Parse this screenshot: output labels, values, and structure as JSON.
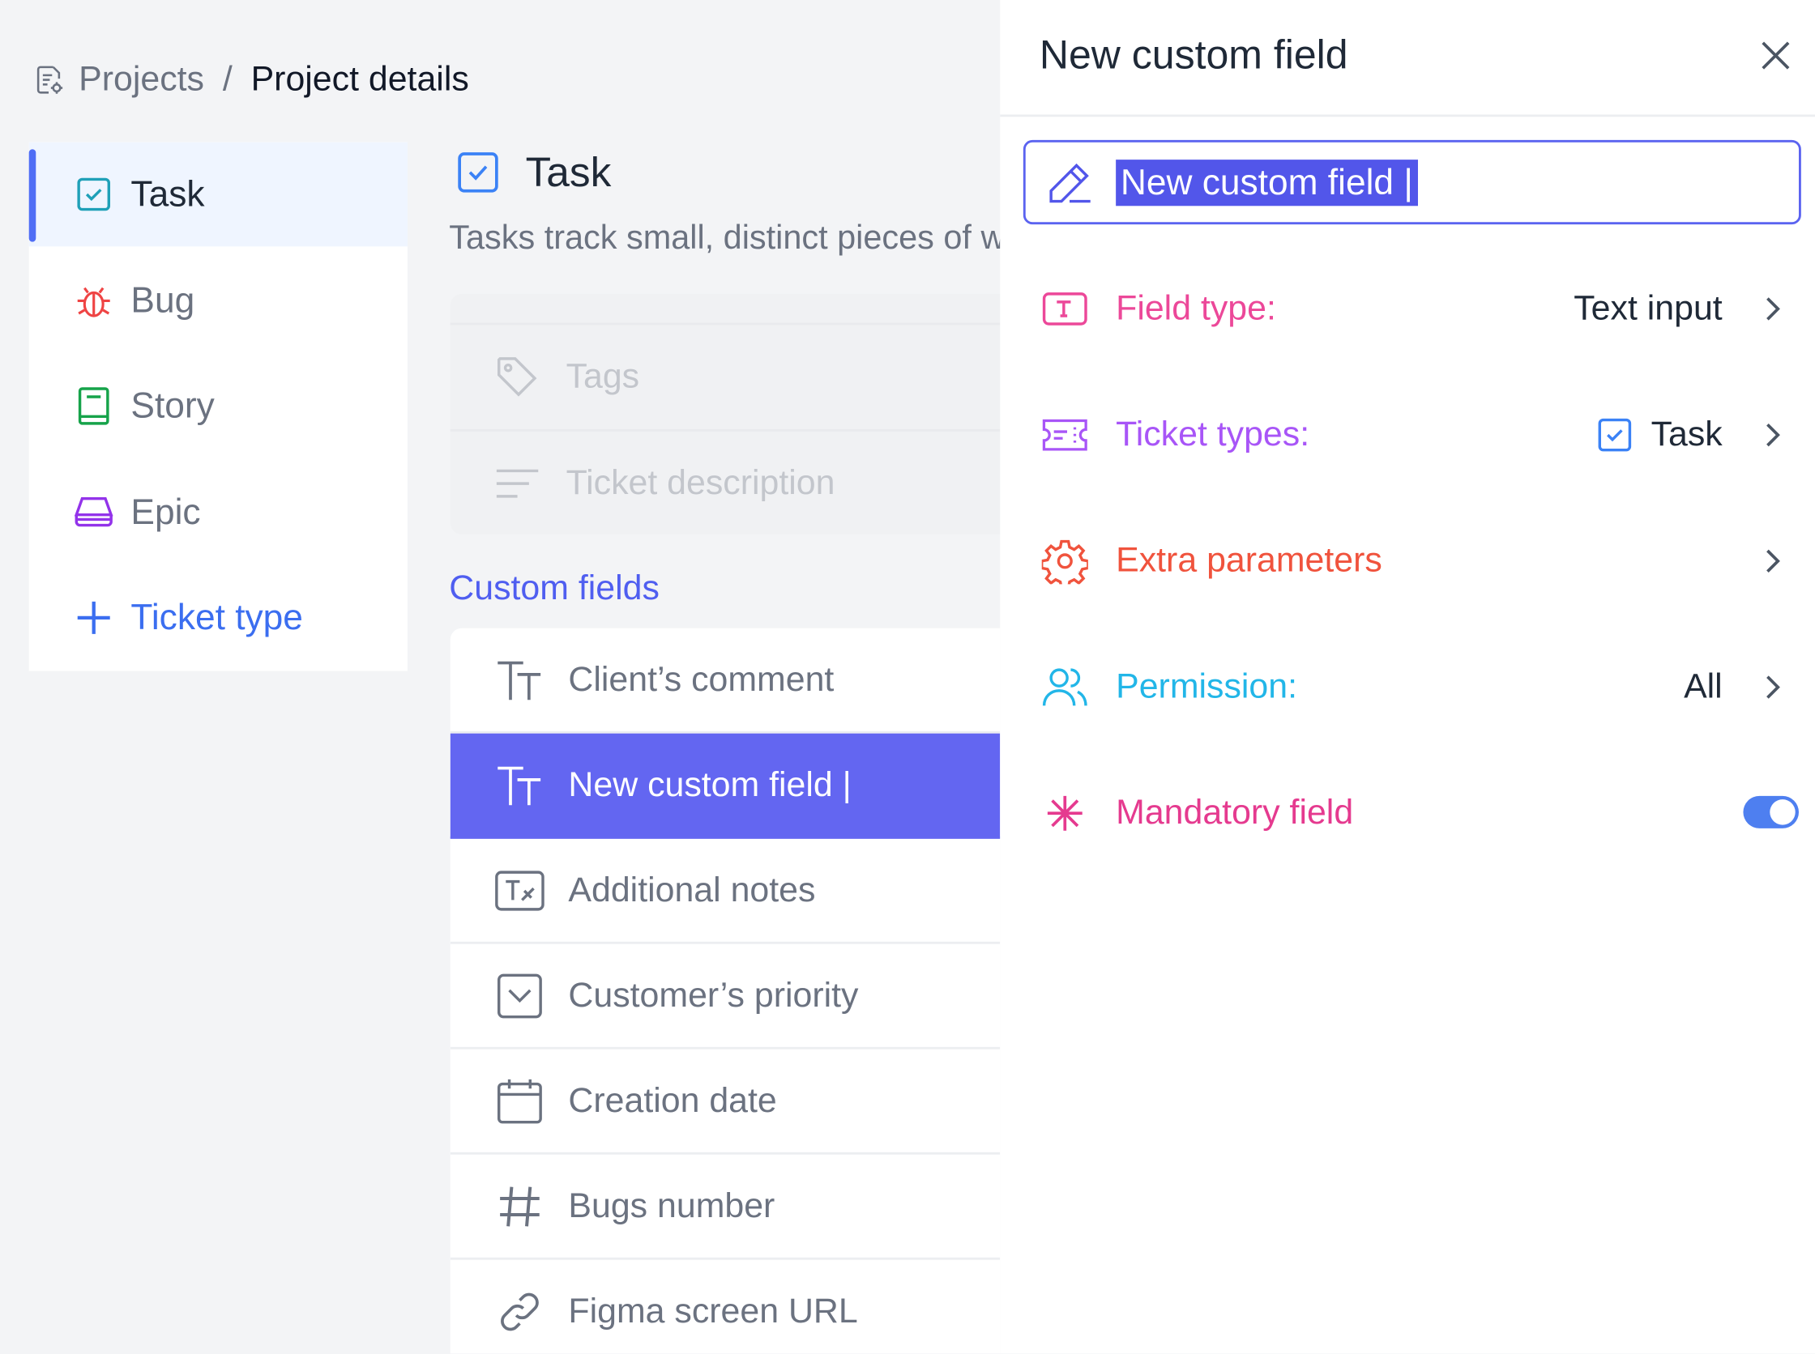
{
  "breadcrumb": {
    "icon": "document-settings-icon",
    "root": "Projects",
    "separator": "/",
    "current": "Project details"
  },
  "sidebar": {
    "items": [
      {
        "label": "Task",
        "icon": "checkbox-icon",
        "color": "#1fa0b8",
        "active": true
      },
      {
        "label": "Bug",
        "icon": "bug-icon",
        "color": "#ef4444"
      },
      {
        "label": "Story",
        "icon": "book-icon",
        "color": "#16a34a"
      },
      {
        "label": "Epic",
        "icon": "layers-icon",
        "color": "#9333ea"
      },
      {
        "label": "Ticket type",
        "icon": "plus-icon",
        "color": "#3b6ef0"
      }
    ]
  },
  "main": {
    "title": "Task",
    "description": "Tasks track small, distinct pieces of work",
    "standard_fields": [
      {
        "label": "Tags",
        "icon": "tag-icon"
      },
      {
        "label": "Ticket description",
        "icon": "text-lines-icon"
      }
    ],
    "custom_fields_title": "Custom fields",
    "custom_fields": [
      {
        "label": "Client’s comment",
        "icon": "text-type-icon"
      },
      {
        "label": "New custom field |",
        "icon": "text-type-icon",
        "selected": true
      },
      {
        "label": "Additional notes",
        "icon": "text-box-icon"
      },
      {
        "label": "Customer’s priority",
        "icon": "dropdown-icon"
      },
      {
        "label": "Creation date",
        "icon": "calendar-icon"
      },
      {
        "label": "Bugs number",
        "icon": "hash-icon"
      },
      {
        "label": "Figma screen URL",
        "icon": "link-icon"
      }
    ]
  },
  "panel": {
    "title": "New custom field",
    "close_icon": "close-icon",
    "name_value": "New custom field |",
    "properties": {
      "field_type": {
        "label": "Field type:",
        "value": "Text input",
        "color": "#ec4899"
      },
      "ticket_types": {
        "label": "Ticket types:",
        "value": "Task",
        "color": "#a855f7"
      },
      "extra_parameters": {
        "label": "Extra parameters",
        "color": "#f0533d"
      },
      "permission": {
        "label": "Permission:",
        "value": "All",
        "color": "#22b6e8"
      },
      "mandatory": {
        "label": "Mandatory field",
        "color": "#e53a8f",
        "enabled": true
      }
    }
  },
  "colors": {
    "accent": "#6366f1",
    "toggle_on": "#4e7ff0"
  }
}
